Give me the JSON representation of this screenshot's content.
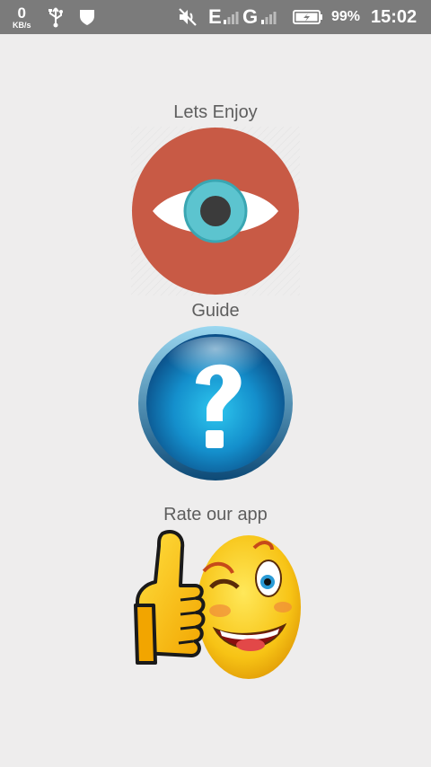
{
  "status_bar": {
    "net_speed_value": "0",
    "net_speed_unit": "KB/s",
    "network_type_1": "E",
    "network_type_2": "G",
    "battery_percent": "99%",
    "time": "15:02",
    "icons": [
      "usb-icon",
      "shield-icon",
      "mute-icon",
      "signal-icon",
      "signal-icon",
      "battery-charging-icon"
    ]
  },
  "menu": {
    "items": [
      {
        "label": "Lets Enjoy",
        "icon": "eye-icon"
      },
      {
        "label": "Guide",
        "icon": "question-mark-icon"
      },
      {
        "label": "Rate our app",
        "icon": "thumbs-up-smiley-icon"
      }
    ]
  },
  "colors": {
    "background": "#eeeded",
    "status_bar": "#7b7b7b",
    "label_text": "#5e5e5e",
    "eye_circle": "#c85a45",
    "eye_iris": "#5cc4cf",
    "guide_blue": "#1a9bd6",
    "smiley_yellow": "#f7c315"
  }
}
